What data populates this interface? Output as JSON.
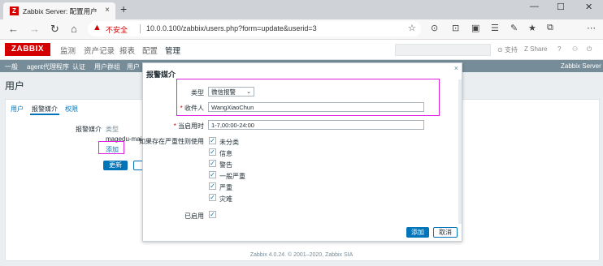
{
  "browser": {
    "tab_title": "Zabbix Server: 配置用户",
    "url": "10.0.0.100/zabbix/users.php?form=update&userid=3",
    "security_label": "不安全"
  },
  "zabbix": {
    "logo": "ZABBIX",
    "menu": [
      "监测",
      "资产记录",
      "报表",
      "配置",
      "管理"
    ],
    "header_links": {
      "support": "支持",
      "share": "Share",
      "help": "?"
    },
    "submenu": [
      "一般",
      "agent代理程序",
      "认证",
      "用户群组",
      "用户"
    ],
    "server_name": "Zabbix Server"
  },
  "page": {
    "title": "用户",
    "tabs": [
      "用户",
      "报警媒介",
      "权限"
    ],
    "media_label": "报警媒介",
    "type_header": "类型",
    "existing_media": "magedu-mail",
    "add_link": "添加",
    "update_button": "更新"
  },
  "modal": {
    "title": "报警媒介",
    "type_label": "类型",
    "type_value": "微信报警",
    "recipient_label": "收件人",
    "recipient_value": "WangXiaoChun",
    "when_active_label": "当启用时",
    "when_active_value": "1-7,00:00-24:00",
    "severity_label": "如果存在严重性则使用",
    "severities": [
      "未分类",
      "信息",
      "警告",
      "一般严重",
      "严重",
      "灾难"
    ],
    "enabled_label": "已启用",
    "add_button": "添加",
    "cancel_button": "取消"
  },
  "footer": "Zabbix 4.0.24. © 2001–2020, Zabbix SIA",
  "colors": {
    "brand": "#d40000",
    "accent": "#0275b8",
    "highlight": "#e020e0"
  }
}
